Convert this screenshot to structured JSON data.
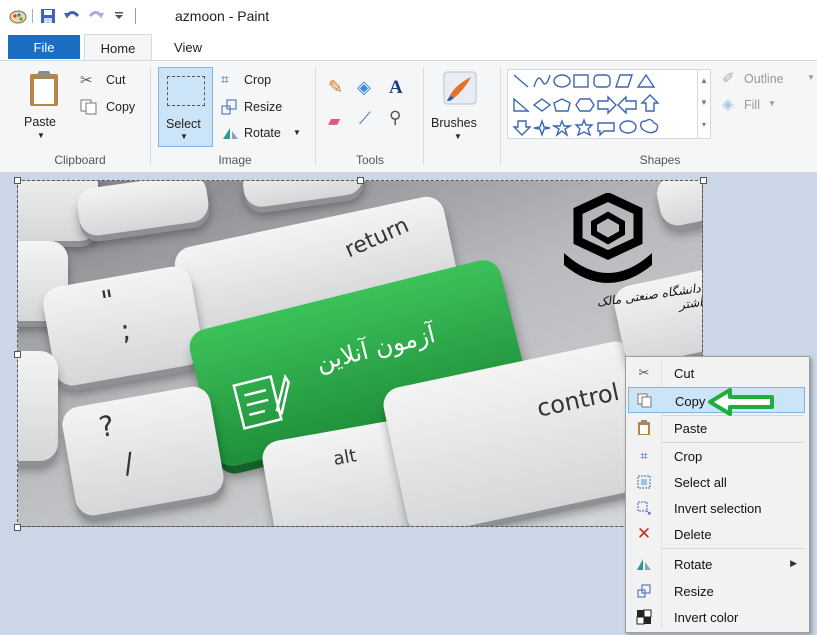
{
  "window": {
    "title": "azmoon - Paint"
  },
  "quick_access": [
    "paint-app-icon",
    "save-icon",
    "undo-icon",
    "redo-icon",
    "customize-dropdown-icon"
  ],
  "tabs": {
    "file": "File",
    "home": "Home",
    "view": "View"
  },
  "ribbon": {
    "clipboard": {
      "paste": "Paste",
      "cut": "Cut",
      "copy": "Copy",
      "label": "Clipboard"
    },
    "image": {
      "select": "Select",
      "crop": "Crop",
      "resize": "Resize",
      "rotate": "Rotate",
      "label": "Image"
    },
    "tools": {
      "label": "Tools",
      "text_tool": "A"
    },
    "brushes": {
      "label": "Brushes"
    },
    "shapes": {
      "label": "Shapes",
      "outline": "Outline",
      "fill": "Fill"
    }
  },
  "canvas_image": {
    "keys": {
      "return": "return",
      "control": "control",
      "alt": "alt",
      "question": "?",
      "slash": "/",
      "quote": "\"",
      "semicolon": ";"
    },
    "green_key_text": "آزمون آنلاین",
    "logo_text": "دانشگاه صنعتی مالک اشتر"
  },
  "context_menu": [
    {
      "key": "cut",
      "label": "Cut",
      "icon": "scissors-icon"
    },
    {
      "key": "copy",
      "label": "Copy",
      "icon": "copy-icon",
      "highlighted": true
    },
    {
      "key": "paste",
      "label": "Paste",
      "icon": "clipboard-icon"
    },
    {
      "key": "crop",
      "label": "Crop",
      "icon": "crop-icon"
    },
    {
      "key": "select_all",
      "label": "Select all",
      "icon": "select-all-icon"
    },
    {
      "key": "invert_selection",
      "label": "Invert selection",
      "icon": "invert-selection-icon"
    },
    {
      "key": "delete",
      "label": "Delete",
      "icon": "delete-x-icon"
    },
    {
      "key": "rotate",
      "label": "Rotate",
      "icon": "rotate-icon",
      "submenu": true
    },
    {
      "key": "resize",
      "label": "Resize",
      "icon": "resize-icon"
    },
    {
      "key": "invert_color",
      "label": "Invert color",
      "icon": "invert-color-icon"
    }
  ],
  "colors": {
    "file_tab": "#1b6ec2",
    "workspace": "#cbd7e6",
    "green_key": "#2eaa4a",
    "arrow": "#1fae3d",
    "menu_highlight": "#cce4f7"
  }
}
